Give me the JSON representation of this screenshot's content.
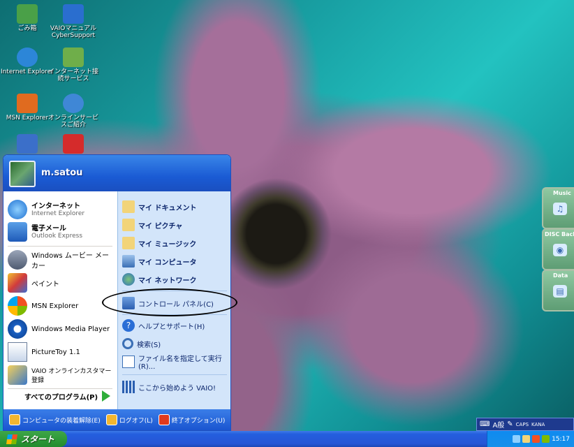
{
  "desktop": {
    "icons": [
      {
        "label": "ごみ箱",
        "icon": "recycle-bin-icon",
        "color": "#4aa048"
      },
      {
        "label": "VAIOマニュアル CyberSupport",
        "icon": "vaio-manual-icon",
        "color": "#2a6ecf"
      },
      {
        "label": "Internet Explorer",
        "icon": "internet-explorer-icon",
        "color": "#2c86d8"
      },
      {
        "label": "インターネット接続サービス",
        "icon": "isp-signup-icon",
        "color": "#6fae4a"
      },
      {
        "label": "MSN Explorer",
        "icon": "msn-explorer-icon",
        "color": "#e06b1f"
      },
      {
        "label": "オンラインサービスご紹介",
        "icon": "online-services-icon",
        "color": "#3f87d6"
      },
      {
        "label": "",
        "icon": "shortcut-icon-a",
        "color": "#3b6fc9"
      },
      {
        "label": "",
        "icon": "dekiru-shortcut-icon",
        "color": "#d52b2b"
      }
    ]
  },
  "gadgets": [
    {
      "label": "Music",
      "icon": "music-note-icon"
    },
    {
      "label": "DISC Backup",
      "icon": "disc-backup-icon"
    },
    {
      "label": "Data",
      "icon": "data-folder-icon"
    }
  ],
  "start_menu": {
    "user": "m.satou",
    "pinned": [
      {
        "title": "インターネット",
        "subtitle": "Internet Explorer",
        "icon": "internet-explorer-icon"
      },
      {
        "title": "電子メール",
        "subtitle": "Outlook Express",
        "icon": "outlook-express-icon"
      }
    ],
    "recent": [
      {
        "label": "Windows ムービー メーカー",
        "icon": "movie-maker-icon"
      },
      {
        "label": "ペイント",
        "icon": "paint-icon"
      },
      {
        "label": "MSN Explorer",
        "icon": "msn-butterfly-icon"
      },
      {
        "label": "Windows Media Player",
        "icon": "media-player-icon"
      },
      {
        "label": "PictureToy 1.1",
        "icon": "picturetoy-icon"
      },
      {
        "label": "VAIO オンラインカスタマー登録",
        "icon": "vaio-registration-icon"
      }
    ],
    "all_programs": "すべてのプログラム(P)",
    "places": [
      {
        "label": "マイ ドキュメント",
        "icon": "my-documents-icon",
        "bold": true
      },
      {
        "label": "マイ ピクチャ",
        "icon": "my-pictures-icon",
        "bold": true
      },
      {
        "label": "マイ ミュージック",
        "icon": "my-music-icon",
        "bold": true
      },
      {
        "label": "マイ コンピュータ",
        "icon": "my-computer-icon",
        "bold": true
      },
      {
        "label": "マイ ネットワーク",
        "icon": "my-network-icon",
        "bold": true
      },
      {
        "label": "コントロール パネル(C)",
        "icon": "control-panel-icon",
        "bold": false
      },
      {
        "label": "ヘルプとサポート(H)",
        "icon": "help-support-icon",
        "bold": false
      },
      {
        "label": "検索(S)",
        "icon": "search-icon",
        "bold": false
      },
      {
        "label": "ファイル名を指定して実行(R)...",
        "icon": "run-icon",
        "bold": false
      },
      {
        "label": "ここから始めよう VAIO!",
        "icon": "vaio-start-icon",
        "bold": false
      }
    ],
    "footer": {
      "undock": "コンピュータの装着解除(E)",
      "logoff": "ログオフ(L)",
      "shutdown": "終了オプション(U)"
    }
  },
  "language_bar": {
    "ime_mode": "A般",
    "caps": "CAPS",
    "kana": "KANA"
  },
  "taskbar": {
    "start_label": "スタート",
    "clock": "15:17"
  },
  "colors": {
    "menu_blue": "#1a5bd4",
    "places_bg": "#d3e5fa",
    "start_green": "#2f9a39",
    "tray_blue": "#1590ea"
  }
}
